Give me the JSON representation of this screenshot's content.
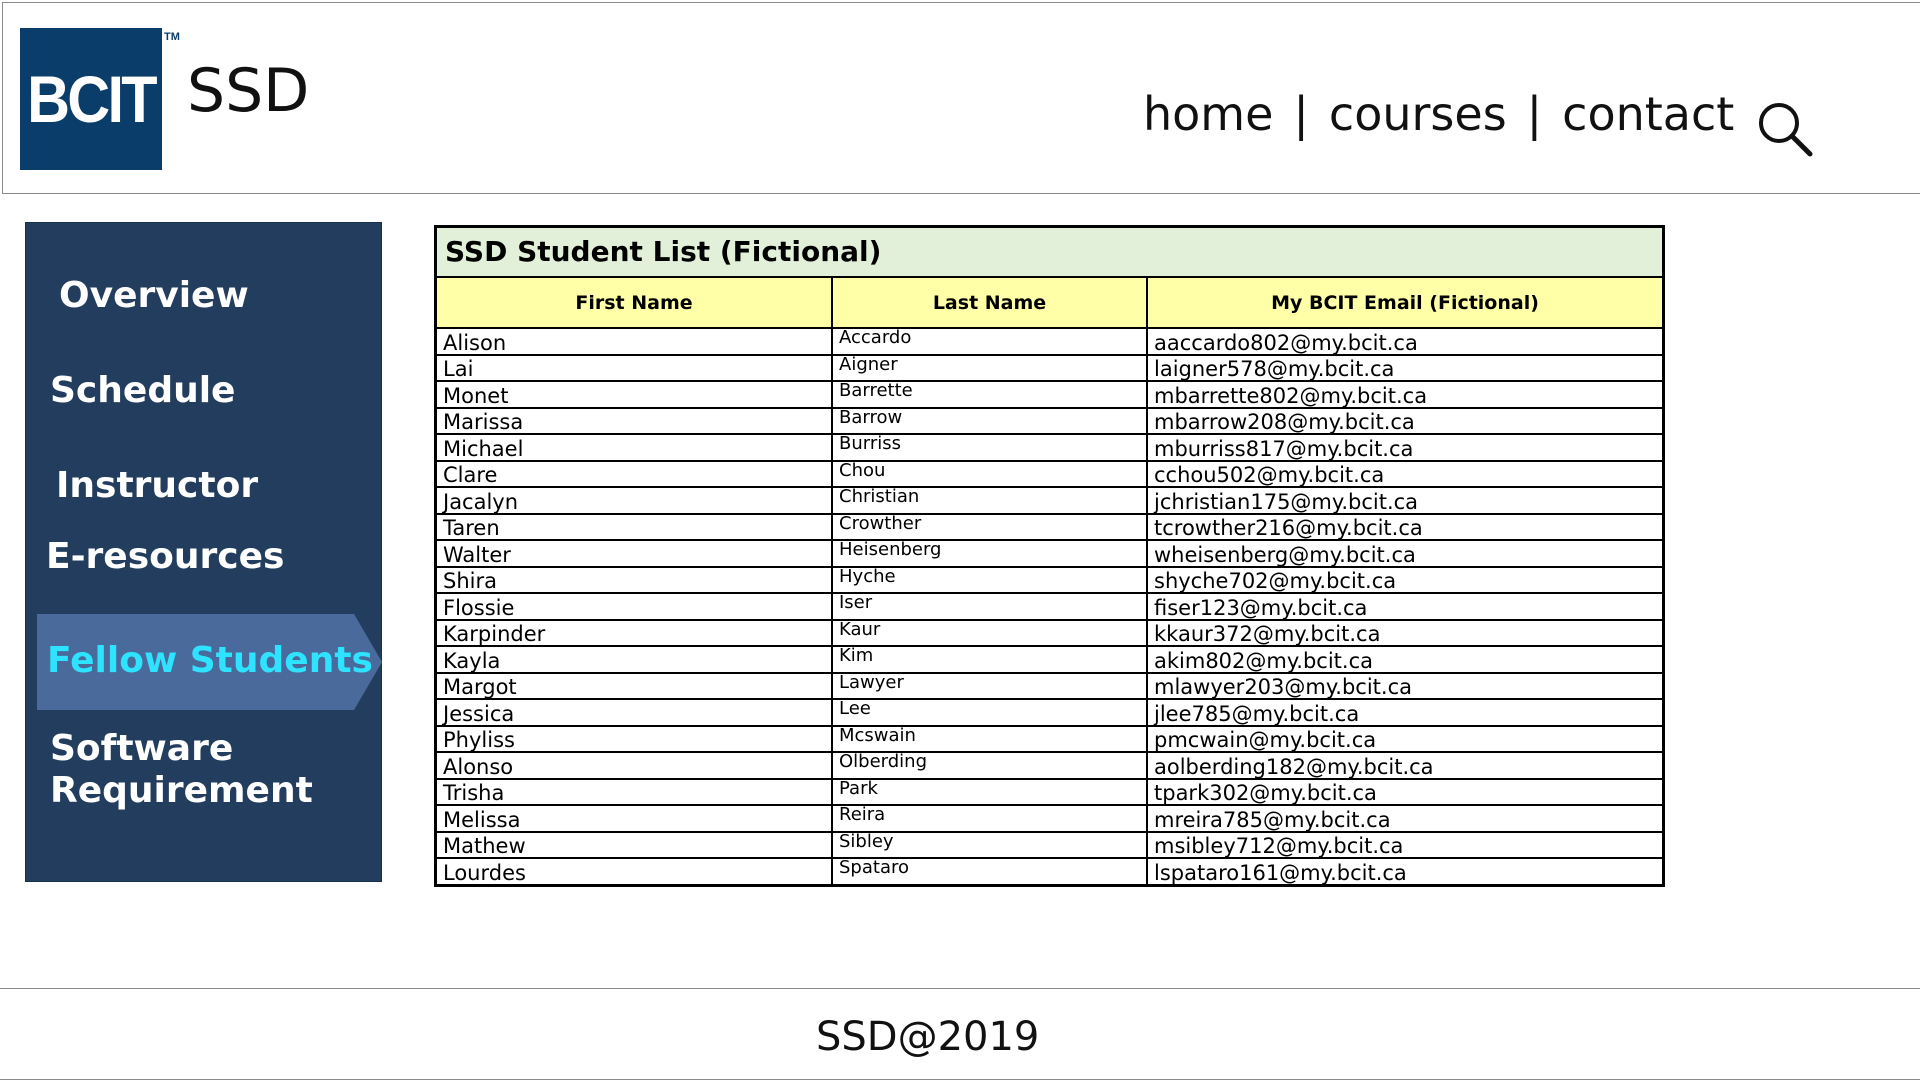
{
  "header": {
    "logo_text": "BCIT",
    "logo_tm": "TM",
    "site_title": "SSD",
    "nav": {
      "home": "home",
      "courses": "courses",
      "contact": "contact",
      "separator": "|"
    },
    "search_icon": "search-icon"
  },
  "sidebar": {
    "items": [
      {
        "label": "Overview"
      },
      {
        "label": "Schedule"
      },
      {
        "label": "Instructor"
      },
      {
        "label": "E-resources"
      },
      {
        "label": "Fellow Students",
        "active": true
      },
      {
        "label_line1": "Software",
        "label_line2": "Requirement"
      }
    ],
    "colors": {
      "background": "#223d5d",
      "active_background": "#4a6a9c",
      "active_text": "#2ee3ff"
    }
  },
  "table": {
    "title": "SSD Student List (Fictional)",
    "headers": [
      "First Name",
      "Last Name",
      "My BCIT Email (Fictional)"
    ],
    "rows": [
      [
        "Alison",
        "Accardo",
        "aaccardo802@my.bcit.ca"
      ],
      [
        "Lai",
        "Aigner",
        "laigner578@my.bcit.ca"
      ],
      [
        "Monet",
        "Barrette",
        "mbarrette802@my.bcit.ca"
      ],
      [
        "Marissa",
        "Barrow",
        "mbarrow208@my.bcit.ca"
      ],
      [
        "Michael",
        "Burriss",
        "mburriss817@my.bcit.ca"
      ],
      [
        "Clare",
        "Chou",
        "cchou502@my.bcit.ca"
      ],
      [
        "Jacalyn",
        "Christian",
        "jchristian175@my.bcit.ca"
      ],
      [
        "Taren",
        "Crowther",
        "tcrowther216@my.bcit.ca"
      ],
      [
        "Walter",
        "Heisenberg",
        "wheisenberg@my.bcit.ca"
      ],
      [
        "Shira",
        "Hyche",
        "shyche702@my.bcit.ca"
      ],
      [
        "Flossie",
        "Iser",
        "fiser123@my.bcit.ca"
      ],
      [
        "Karpinder",
        "Kaur",
        "kkaur372@my.bcit.ca"
      ],
      [
        "Kayla",
        "Kim",
        "akim802@my.bcit.ca"
      ],
      [
        "Margot",
        "Lawyer",
        "mlawyer203@my.bcit.ca"
      ],
      [
        "Jessica",
        "Lee",
        "jlee785@my.bcit.ca"
      ],
      [
        "Phyliss",
        "Mcswain",
        "pmcwain@my.bcit.ca"
      ],
      [
        "Alonso",
        "Olberding",
        "aolberding182@my.bcit.ca"
      ],
      [
        "Trisha",
        "Park",
        "tpark302@my.bcit.ca"
      ],
      [
        "Melissa",
        "Reira",
        "mreira785@my.bcit.ca"
      ],
      [
        "Mathew",
        "Sibley",
        "msibley712@my.bcit.ca"
      ],
      [
        "Lourdes",
        "Spataro",
        "lspataro161@my.bcit.ca"
      ]
    ],
    "colors": {
      "title_bg": "#e2efd9",
      "header_bg": "#ffffa8"
    }
  },
  "footer": {
    "text": "SSD@2019"
  }
}
